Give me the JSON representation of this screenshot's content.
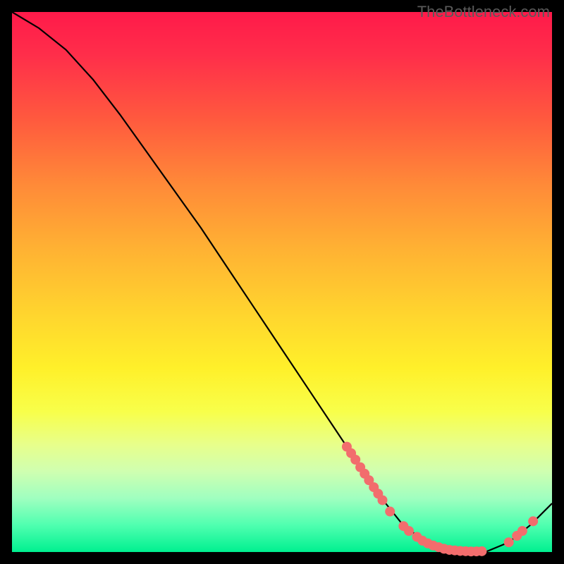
{
  "watermark": "TheBottleneck.com",
  "chart_data": {
    "type": "line",
    "title": "",
    "xlabel": "",
    "ylabel": "",
    "xlim": [
      0,
      100
    ],
    "ylim": [
      0,
      100
    ],
    "curve": {
      "x": [
        0,
        5,
        10,
        15,
        20,
        25,
        30,
        35,
        40,
        45,
        50,
        55,
        60,
        62,
        65,
        68,
        70,
        72,
        75,
        78,
        80,
        82,
        84,
        85,
        88,
        92,
        96,
        100
      ],
      "y": [
        100,
        97,
        93,
        87.5,
        81,
        74,
        67,
        60,
        52.5,
        45,
        37.5,
        30,
        22.5,
        19.5,
        15,
        10.5,
        8,
        5.5,
        3,
        1.3,
        0.6,
        0.3,
        0.15,
        0.1,
        0.15,
        1.8,
        5,
        9
      ]
    },
    "scatter": {
      "points": [
        {
          "x": 62.0,
          "y": 19.5
        },
        {
          "x": 62.8,
          "y": 18.3
        },
        {
          "x": 63.6,
          "y": 17.1
        },
        {
          "x": 64.5,
          "y": 15.7
        },
        {
          "x": 65.3,
          "y": 14.5
        },
        {
          "x": 66.1,
          "y": 13.3
        },
        {
          "x": 67.0,
          "y": 12.0
        },
        {
          "x": 67.8,
          "y": 10.8
        },
        {
          "x": 68.6,
          "y": 9.6
        },
        {
          "x": 70.0,
          "y": 7.5
        },
        {
          "x": 72.5,
          "y": 4.8
        },
        {
          "x": 73.5,
          "y": 3.9
        },
        {
          "x": 75.0,
          "y": 2.8
        },
        {
          "x": 76.0,
          "y": 2.1
        },
        {
          "x": 77.0,
          "y": 1.6
        },
        {
          "x": 78.0,
          "y": 1.2
        },
        {
          "x": 79.0,
          "y": 0.9
        },
        {
          "x": 80.0,
          "y": 0.6
        },
        {
          "x": 81.0,
          "y": 0.4
        },
        {
          "x": 82.0,
          "y": 0.3
        },
        {
          "x": 83.0,
          "y": 0.2
        },
        {
          "x": 84.0,
          "y": 0.15
        },
        {
          "x": 85.0,
          "y": 0.1
        },
        {
          "x": 86.0,
          "y": 0.12
        },
        {
          "x": 87.0,
          "y": 0.15
        },
        {
          "x": 92.0,
          "y": 1.8
        },
        {
          "x": 93.5,
          "y": 3.0
        },
        {
          "x": 94.5,
          "y": 3.9
        },
        {
          "x": 96.5,
          "y": 5.7
        }
      ],
      "color": "#f26d6d",
      "radius": 7
    }
  }
}
